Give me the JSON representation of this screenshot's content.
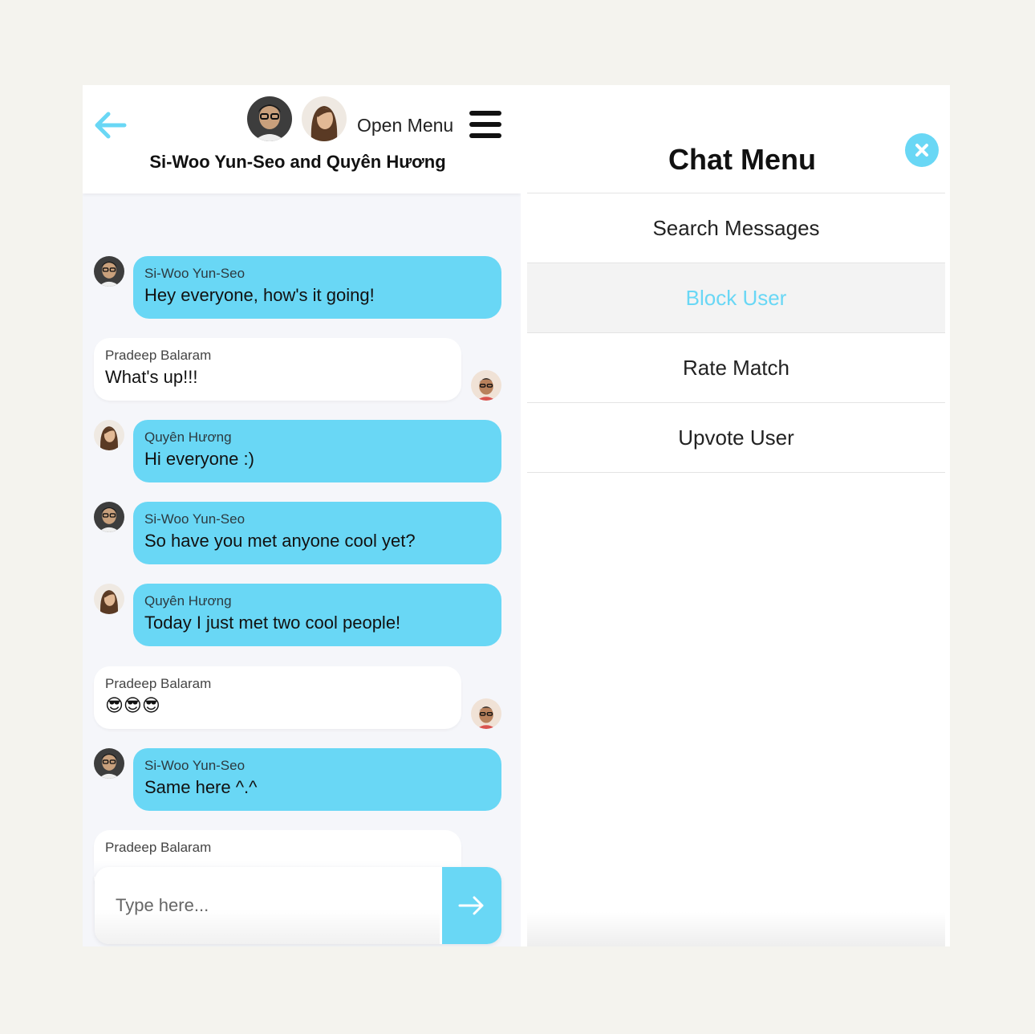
{
  "header": {
    "back_icon": "arrow-left-icon",
    "open_menu_label": "Open Menu",
    "menu_icon": "hamburger-icon",
    "title": "Si-Woo Yun-Seo and Quyên Hương",
    "accent_color": "#69d7f5"
  },
  "messages": [
    {
      "sender": "Si-Woo Yun-Seo",
      "text": "Hey everyone, how's it going!",
      "direction": "incoming"
    },
    {
      "sender": "Pradeep Balaram",
      "text": "What's up!!!",
      "direction": "outgoing"
    },
    {
      "sender": "Quyên Hương",
      "text": "Hi everyone :)",
      "direction": "incoming"
    },
    {
      "sender": "Si-Woo Yun-Seo",
      "text": "So have you met anyone cool yet?",
      "direction": "incoming"
    },
    {
      "sender": "Quyên Hương",
      "text": "Today I just met two cool people!",
      "direction": "incoming"
    },
    {
      "sender": "Pradeep Balaram",
      "text": "😎😎😎",
      "direction": "outgoing"
    },
    {
      "sender": "Si-Woo Yun-Seo",
      "text": "Same here ^.^",
      "direction": "incoming"
    },
    {
      "sender": "Pradeep Balaram",
      "text": "",
      "direction": "outgoing"
    }
  ],
  "composer": {
    "placeholder": "Type here...",
    "send_icon": "arrow-right-icon"
  },
  "menu": {
    "title": "Chat Menu",
    "close_icon": "close-icon",
    "items": [
      {
        "label": "Search Messages"
      },
      {
        "label": "Block User",
        "active": true
      },
      {
        "label": "Rate Match"
      },
      {
        "label": "Upvote User"
      }
    ]
  }
}
